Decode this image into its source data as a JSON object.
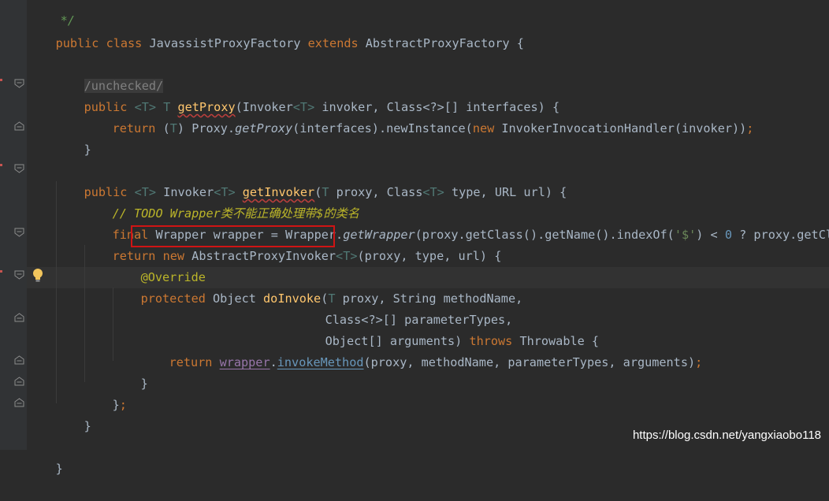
{
  "editor": {
    "line_a": {
      "t1": "public class ",
      "t2": "JavassistProxyFactory ",
      "t3": "extends ",
      "t4": "AbstractProxyFactory {"
    },
    "line_b": {
      "t1": "/unchecked/"
    },
    "line_c": {
      "t1": "public ",
      "t2": "<T> ",
      "t3": "T ",
      "t4": "getProxy",
      "t5": "(Invoker",
      "t6": "<T>",
      "t7": " invoker, Class<?>[] interfaces) {"
    },
    "line_d": {
      "t1": "return ",
      "t2": "(",
      "t3": "T",
      "t4": ") Proxy.",
      "t5": "getProxy",
      "t6": "(interfaces).newInstance(",
      "t7": "new ",
      "t8": "InvokerInvocationHandler(invoker))",
      "t9": ";"
    },
    "line_e": {
      "t1": "}"
    },
    "line_f": {
      "t1": "public ",
      "t2": "<T> ",
      "t3": "Invoker",
      "t4": "<T> ",
      "t5": "getInvoker",
      "t6": "(",
      "t7": "T ",
      "t8": "proxy, Class",
      "t9": "<T> ",
      "t10": "type, URL url) {"
    },
    "line_g": {
      "t1": "// TODO Wrapper类不能正确处理带$的类名"
    },
    "line_h": {
      "t1": "final ",
      "t2": "Wrapper wrapper = Wrapper.",
      "t3": "getWrapper",
      "t4": "(proxy.getClass().getName().indexOf(",
      "t5": "'$'",
      "t6": ") < ",
      "t7": "0 ",
      "t8": "? proxy.getClass()"
    },
    "line_i": {
      "t1": "return ",
      "t2": "new ",
      "t3": "AbstractProxyInvoker",
      "t4": "<T>",
      "t5": "(proxy, type, url) {"
    },
    "line_j": {
      "t1": "@Override"
    },
    "line_k": {
      "t1": "protected ",
      "t2": "Object ",
      "t3": "doInvoke",
      "t4": "(",
      "t5": "T ",
      "t6": "proxy, String methodName,"
    },
    "line_l": {
      "t1": "Class<?>[] parameterTypes,"
    },
    "line_m": {
      "t1": "Object[] arguments) ",
      "t2": "throws ",
      "t3": "Throwable {"
    },
    "line_n": {
      "t1": "return ",
      "t2": "wrapper",
      "t3": ".",
      "t4": "invokeMethod",
      "t5": "(proxy, methodName, parameterTypes, arguments)",
      "t6": ";"
    },
    "line_o": {
      "t1": "}"
    },
    "line_p": {
      "t1": "}",
      "t2": ";"
    },
    "line_q": {
      "t1": "}"
    },
    "line_r": {
      "t1": "}"
    },
    "line_top": {
      "t1": "*/"
    }
  },
  "watermark": "https://blog.csdn.net/yangxiaobo118",
  "colors": {
    "background": "#2b2b2b",
    "gutter": "#313335",
    "keyword": "#cc7832",
    "method": "#ffc66d",
    "comment": "#629755",
    "highlight_box": "#d01414"
  },
  "icons": {
    "fold": "fold-marker-icon",
    "bulb": "lightbulb-icon"
  }
}
